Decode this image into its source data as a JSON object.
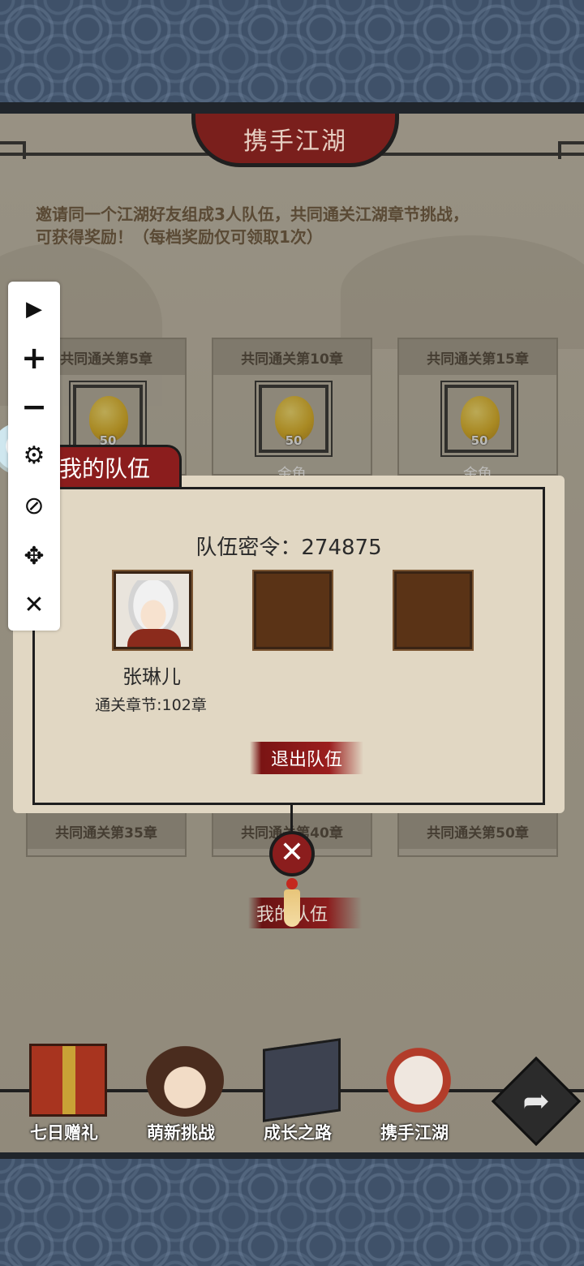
{
  "title": "携手江湖",
  "intro": {
    "line1": "邀请同一个江湖好友组成3人队伍，共同通关江湖章节挑战，",
    "line2": "可获得奖励！（每档奖励仅可领取1次）"
  },
  "rewards_top": [
    {
      "label": "共同通关第5章",
      "count": "50",
      "item": "金龟"
    },
    {
      "label": "共同通关第10章",
      "count": "50",
      "item": "金龟"
    },
    {
      "label": "共同通关第15章",
      "count": "50",
      "item": "金龟"
    }
  ],
  "rewards_bottom": [
    {
      "label": "共同通关第35章"
    },
    {
      "label": "共同通关第40章"
    },
    {
      "label": "共同通关第50章"
    }
  ],
  "team": {
    "tab_title": "我的队伍",
    "code_text": "队伍密令：274875",
    "member": {
      "name": "张琳儿",
      "stage": "通关章节:102章"
    },
    "leave_label": "退出队伍",
    "bottom_label": "我的队伍"
  },
  "nav": [
    {
      "label": "七日赠礼",
      "icon": "gift-icon"
    },
    {
      "label": "萌新挑战",
      "icon": "girl-avatar-icon"
    },
    {
      "label": "成长之路",
      "icon": "book-icon"
    },
    {
      "label": "携手江湖",
      "icon": "handshake-icon"
    }
  ],
  "toolbar": {
    "play": "▶",
    "zoom_in": "+",
    "zoom_out": "−",
    "settings": "⚙",
    "hide": "⊘",
    "move": "✥",
    "close": "✕"
  },
  "colors": {
    "banner_red": "#7a1f1c",
    "parchment": "#c9c1b0",
    "frame_dark": "#1f1f1f",
    "slot_brown": "#5a3316",
    "swirl_blue": "#3f5169"
  }
}
